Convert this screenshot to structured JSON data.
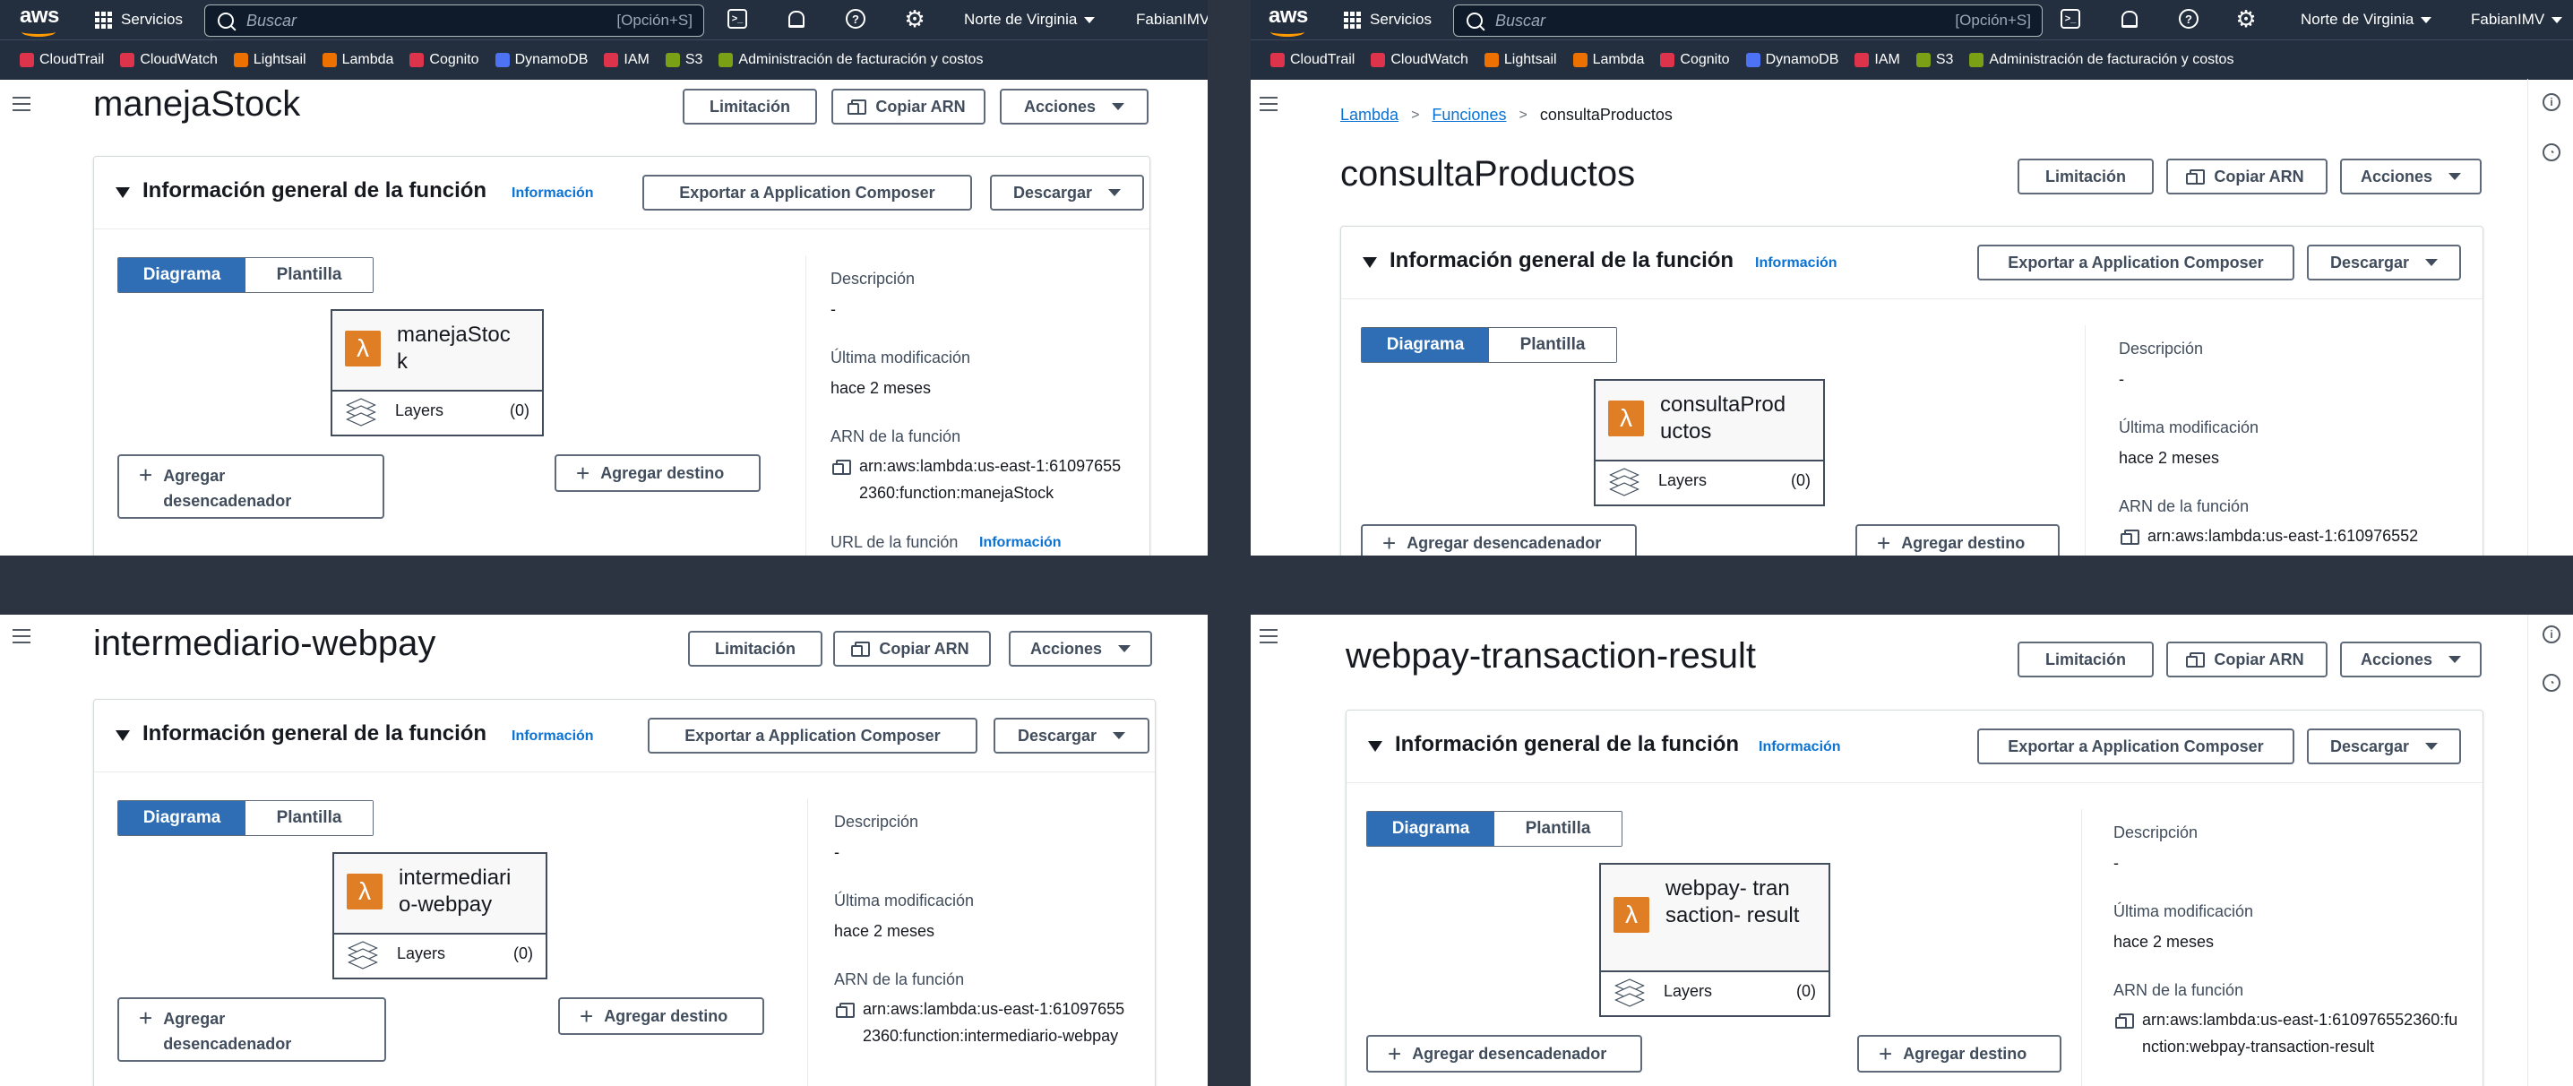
{
  "nav": {
    "logo": "aws",
    "services": "Servicios",
    "search_placeholder": "Buscar",
    "search_shortcut": "[Opción+S]",
    "region": "Norte de Virginia",
    "user": "FabianIMV",
    "favorites": [
      {
        "label": "CloudTrail",
        "icon": "cloudtrail-icon",
        "color": "#dd344c"
      },
      {
        "label": "CloudWatch",
        "icon": "cloudwatch-icon",
        "color": "#dd344c"
      },
      {
        "label": "Lightsail",
        "icon": "lightsail-icon",
        "color": "#ed7100"
      },
      {
        "label": "Lambda",
        "icon": "lambda-icon",
        "color": "#ed7100"
      },
      {
        "label": "Cognito",
        "icon": "cognito-icon",
        "color": "#dd344c"
      },
      {
        "label": "DynamoDB",
        "icon": "dynamodb-icon",
        "color": "#4d72f3"
      },
      {
        "label": "IAM",
        "icon": "iam-icon",
        "color": "#dd344c"
      },
      {
        "label": "S3",
        "icon": "s3-icon",
        "color": "#7aa116"
      },
      {
        "label": "Administración de facturación y costos",
        "icon": "billing-icon",
        "color": "#7aa116"
      }
    ]
  },
  "common": {
    "btn_limit": "Limitación",
    "btn_copy_arn": "Copiar ARN",
    "btn_actions": "Acciones",
    "overview_title": "Información general de la función",
    "info": "Información",
    "btn_export": "Exportar a Application Composer",
    "btn_download": "Descargar",
    "tab_diagram": "Diagrama",
    "tab_template": "Plantilla",
    "layers": "Layers",
    "layers_count": "(0)",
    "add_trigger": "Agregar desencadenador",
    "add_destination": "Agregar destino",
    "desc_label": "Descripción",
    "desc_value": "-",
    "modified_label": "Última modificación",
    "modified_value": "hace 2 meses",
    "arn_label": "ARN de la función",
    "url_label": "URL de la función"
  },
  "breadcrumb": {
    "root": "Lambda",
    "section": "Funciones",
    "current": "consultaProductos"
  },
  "functions": [
    {
      "name": "manejaStock",
      "box_name": "manejaStoc k",
      "arn": "arn:aws:lambda:us-east-1:610976552360:function:manejaStock"
    },
    {
      "name": "consultaProductos",
      "box_name": "consultaProd uctos",
      "arn": "arn:aws:lambda:us-east-1:610976552"
    },
    {
      "name": "intermediario-webpay",
      "box_name": "intermediari o-webpay",
      "arn": "arn:aws:lambda:us-east-1:610976552360:function:intermediario-webpay"
    },
    {
      "name": "webpay-transaction-result",
      "box_name": "webpay- transaction- result",
      "arn": "arn:aws:lambda:us-east-1:610976552360:function:webpay-transaction-result"
    }
  ]
}
